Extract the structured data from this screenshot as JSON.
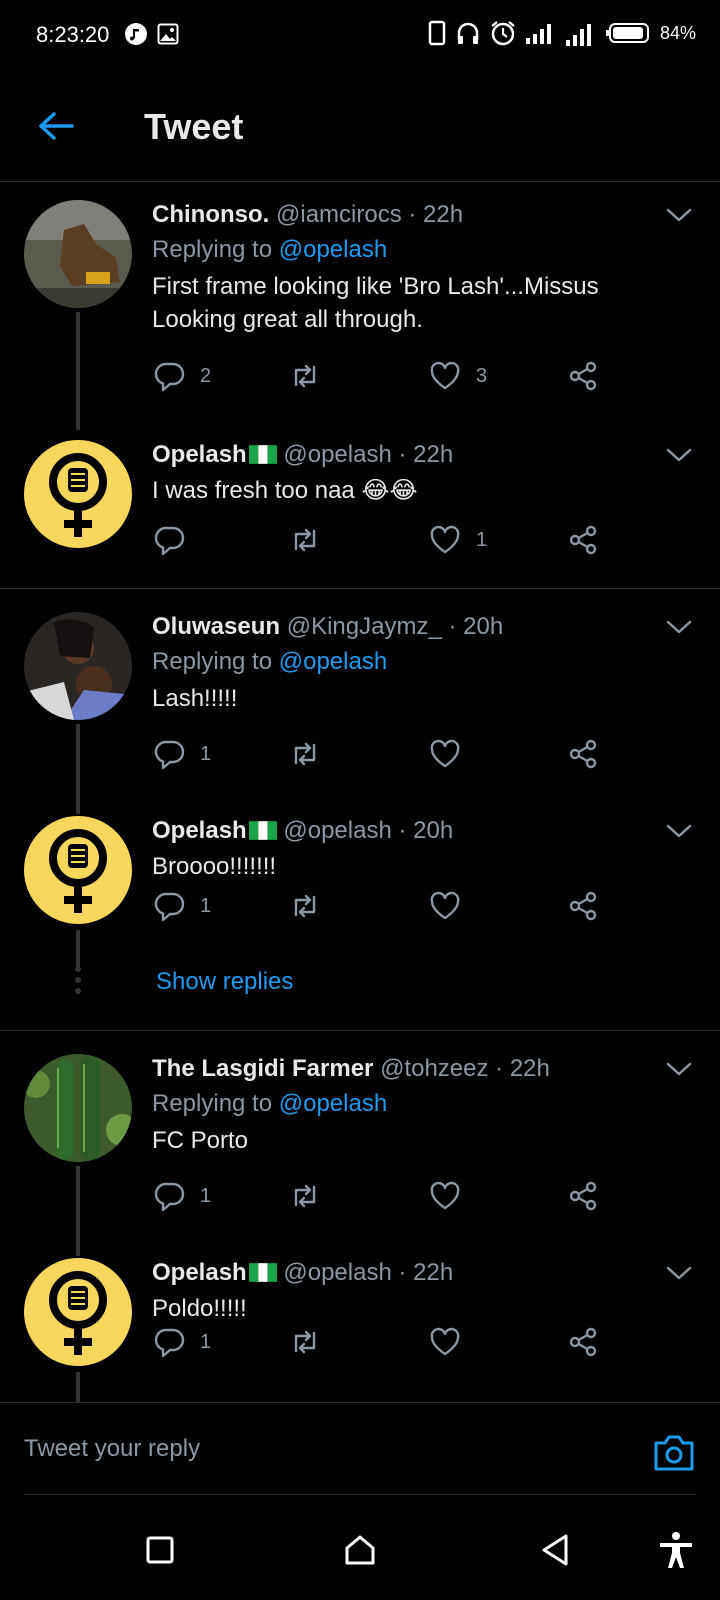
{
  "status_bar": {
    "time": "8:23:20",
    "battery": "84%"
  },
  "header": {
    "title": "Tweet"
  },
  "colors": {
    "background": "#000000",
    "accent": "#1d9bf0",
    "muted": "#8b98a5",
    "avatar_yellow": "#f9d65c"
  },
  "tweets": [
    {
      "name": "Chinonso.",
      "handle": "@iamcirocs",
      "time": "· 22h",
      "replying_label": "Replying to",
      "replying_to": "@opelash",
      "text": "First frame looking like 'Bro Lash'...Missus Looking great all through.",
      "reply_count": "2",
      "like_count": "3",
      "avatar_icon": "boot-photo-avatar"
    },
    {
      "name": "Opelash",
      "handle": "@opelash",
      "time": "· 22h",
      "text": "I was fresh too naa 😂😂",
      "reply_count": "",
      "like_count": "1",
      "avatar_icon": "feminist-fist-avatar"
    },
    {
      "name": "Oluwaseun",
      "handle": "@KingJaymz_",
      "time": "· 20h",
      "replying_label": "Replying to",
      "replying_to": "@opelash",
      "text": "Lash!!!!!",
      "reply_count": "1",
      "like_count": "",
      "avatar_icon": "couple-photo-avatar"
    },
    {
      "name": "Opelash",
      "handle": "@opelash",
      "time": "· 20h",
      "text": "Broooo!!!!!!!",
      "reply_count": "1",
      "like_count": "",
      "avatar_icon": "feminist-fist-avatar"
    },
    {
      "name": "The Lasgidi Farmer",
      "handle": "@tohzeez",
      "time": "· 22h",
      "replying_label": "Replying to",
      "replying_to": "@opelash",
      "text": "FC Porto",
      "reply_count": "1",
      "like_count": "",
      "avatar_icon": "cucumber-photo-avatar"
    },
    {
      "name": "Opelash",
      "handle": "@opelash",
      "time": "· 22h",
      "text": "Poldo!!!!!",
      "reply_count": "1",
      "like_count": "",
      "avatar_icon": "feminist-fist-avatar"
    }
  ],
  "show_replies": "Show replies",
  "reply_bar": {
    "placeholder": "Tweet your reply"
  }
}
